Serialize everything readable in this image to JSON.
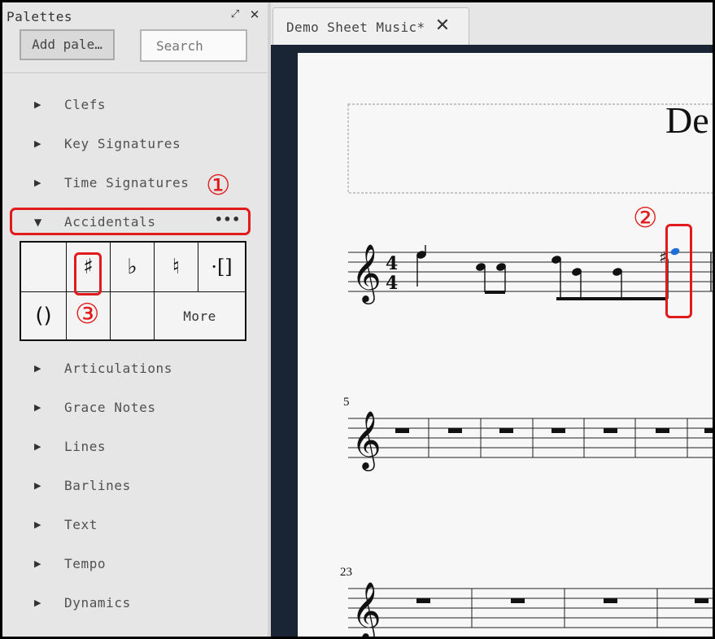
{
  "palettes_panel": {
    "title": "Palettes",
    "add_button_label": "Add pale…",
    "search_placeholder": "Search",
    "palettes": [
      {
        "label": "Clefs",
        "expanded": false
      },
      {
        "label": "Key Signatures",
        "expanded": false
      },
      {
        "label": "Time Signatures",
        "expanded": false
      },
      {
        "label": "Accidentals",
        "expanded": true
      },
      {
        "label": "Articulations",
        "expanded": false
      },
      {
        "label": "Grace Notes",
        "expanded": false
      },
      {
        "label": "Lines",
        "expanded": false
      },
      {
        "label": "Barlines",
        "expanded": false
      },
      {
        "label": "Text",
        "expanded": false
      },
      {
        "label": "Tempo",
        "expanded": false
      },
      {
        "label": "Dynamics",
        "expanded": false
      }
    ],
    "accidentals_more_dots": "•••",
    "accidentals_cells": {
      "sharp": "♯",
      "flat": "♭",
      "natural": "♮",
      "brackets": "·[]",
      "parentheses": "()",
      "more": "More"
    }
  },
  "annotations": {
    "step1": "①",
    "step2": "②",
    "step3": "③",
    "color": "#e11b1b"
  },
  "score": {
    "tab_label": "Demo Sheet Music*",
    "title_fragment": "De",
    "time_signature_top": "4",
    "time_signature_bottom": "4",
    "measure_number_row2": "5",
    "measure_number_row3": "23",
    "selected_note_color": "#1f6fd6",
    "background_color": "#192534"
  }
}
